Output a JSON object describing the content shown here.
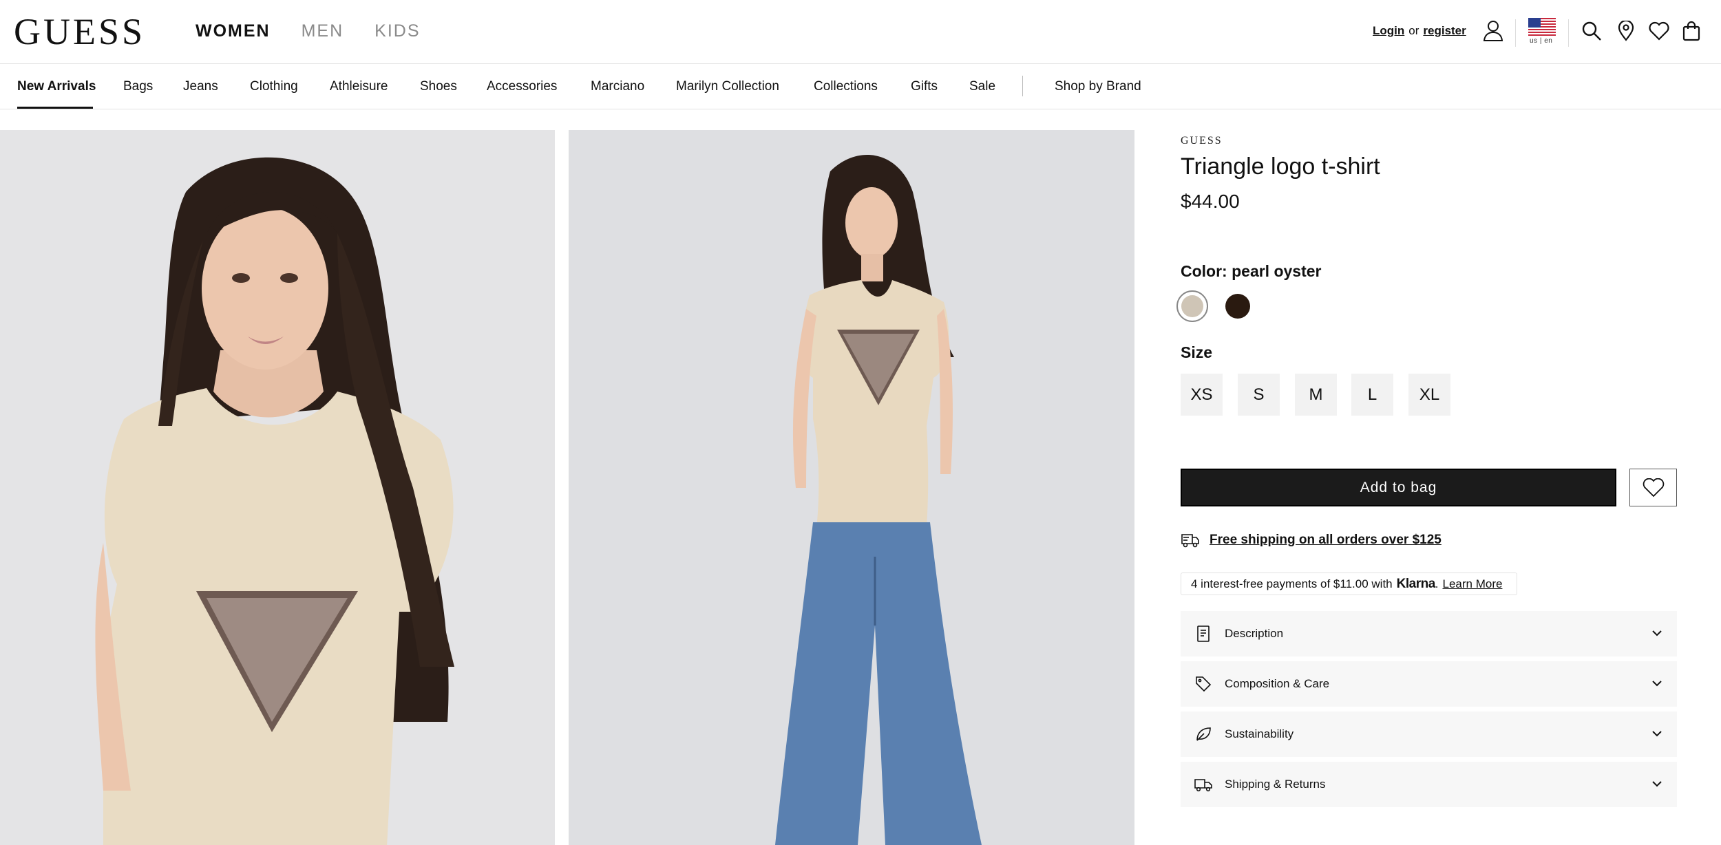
{
  "header": {
    "logo": "GUESS",
    "gender_tabs": [
      {
        "label": "WOMEN",
        "active": true
      },
      {
        "label": "MEN",
        "active": false
      },
      {
        "label": "KIDS",
        "active": false
      }
    ],
    "login_label": "Login",
    "or_label": "or",
    "register_label": "register",
    "locale_label": "us | en",
    "icons": [
      "account-icon",
      "us-flag-icon",
      "search-icon",
      "store-locator-icon",
      "wishlist-icon",
      "bag-icon"
    ]
  },
  "category_nav": {
    "items": [
      "New Arrivals",
      "Bags",
      "Jeans",
      "Clothing",
      "Athleisure",
      "Shoes",
      "Accessories",
      "Marciano",
      "Marilyn Collection",
      "Collections",
      "Gifts",
      "Sale",
      "Shop by Brand"
    ],
    "active": "New Arrivals"
  },
  "product": {
    "brand": "GUESS",
    "title": "Triangle logo t-shirt",
    "price": "$44.00",
    "color_label": "Color: pearl oyster",
    "colors": [
      {
        "name": "pearl oyster",
        "hex": "#cfc5b6",
        "selected": true
      },
      {
        "name": "dark brown",
        "hex": "#2a1a10",
        "selected": false
      }
    ],
    "size_label": "Size",
    "sizes": [
      "XS",
      "S",
      "M",
      "L",
      "XL"
    ],
    "add_to_bag_label": "Add to bag",
    "shipping_text": "Free shipping on all orders over $125",
    "klarna": {
      "prefix": "4 interest-free payments of $11.00 with",
      "brand": "Klarna",
      "dot": ".",
      "learn_more": "Learn More"
    },
    "accordions": [
      {
        "label": "Description",
        "icon": "document-icon"
      },
      {
        "label": "Composition & Care",
        "icon": "tag-icon"
      },
      {
        "label": "Sustainability",
        "icon": "leaf-icon"
      },
      {
        "label": "Shipping & Returns",
        "icon": "truck-icon"
      }
    ]
  },
  "colors": {
    "accent": "#111111",
    "button_bg": "#1b1b1b",
    "accordion_bg": "#f7f7f7",
    "size_bg": "#f2f2f2"
  }
}
